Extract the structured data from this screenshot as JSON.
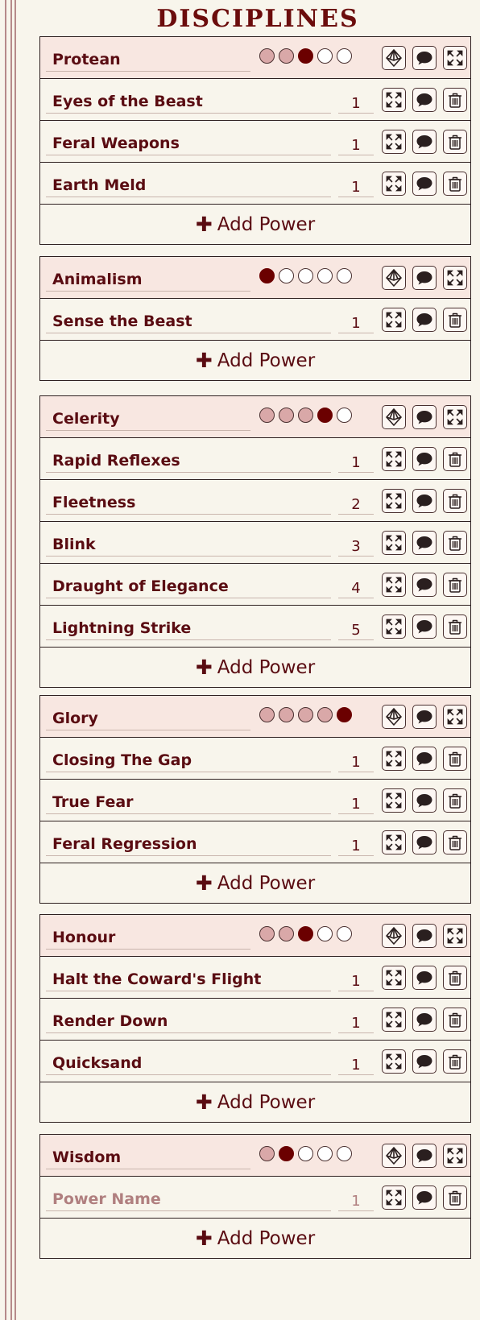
{
  "page": {
    "title": "DISCIPLINES"
  },
  "add_label": "Add Power",
  "disciplines": [
    {
      "name": "Protean",
      "rating": 3,
      "max_rating": 5,
      "powers": [
        {
          "name": "Eyes of the Beast",
          "level": "1"
        },
        {
          "name": "Feral Weapons",
          "level": "1"
        },
        {
          "name": "Earth Meld",
          "level": "1"
        }
      ]
    },
    {
      "name": "Animalism",
      "rating": 1,
      "max_rating": 5,
      "powers": [
        {
          "name": "Sense the Beast",
          "level": "1"
        }
      ]
    },
    {
      "name": "Celerity",
      "rating": 4,
      "max_rating": 5,
      "powers": [
        {
          "name": "Rapid Reflexes",
          "level": "1"
        },
        {
          "name": "Fleetness",
          "level": "2"
        },
        {
          "name": "Blink",
          "level": "3"
        },
        {
          "name": "Draught of Elegance",
          "level": "4"
        },
        {
          "name": "Lightning Strike",
          "level": "5"
        }
      ]
    },
    {
      "name": "Glory",
      "rating": 5,
      "max_rating": 5,
      "powers": [
        {
          "name": "Closing The Gap",
          "level": "1"
        },
        {
          "name": "True Fear",
          "level": "1"
        },
        {
          "name": "Feral Regression",
          "level": "1"
        }
      ]
    },
    {
      "name": "Honour",
      "rating": 3,
      "max_rating": 5,
      "powers": [
        {
          "name": "Halt the Coward's Flight",
          "level": "1"
        },
        {
          "name": "Render Down",
          "level": "1"
        },
        {
          "name": "Quicksand",
          "level": "1"
        }
      ]
    },
    {
      "name": "Wisdom",
      "rating": 2,
      "max_rating": 5,
      "powers": [
        {
          "name": "",
          "placeholder": "Power Name",
          "level": "1"
        }
      ]
    }
  ],
  "colors": {
    "accent": "#6b0c0c",
    "header_bg": "#f8e7e1",
    "dot_filled": "#6b0000",
    "dot_past": "#d9a8a8",
    "page_bg": "#f8f5ec"
  },
  "icons": {
    "header_buttons": [
      "dice-icon",
      "comment-icon",
      "expand-icon"
    ],
    "power_buttons": [
      "expand-icon",
      "comment-icon",
      "trash-icon"
    ]
  }
}
